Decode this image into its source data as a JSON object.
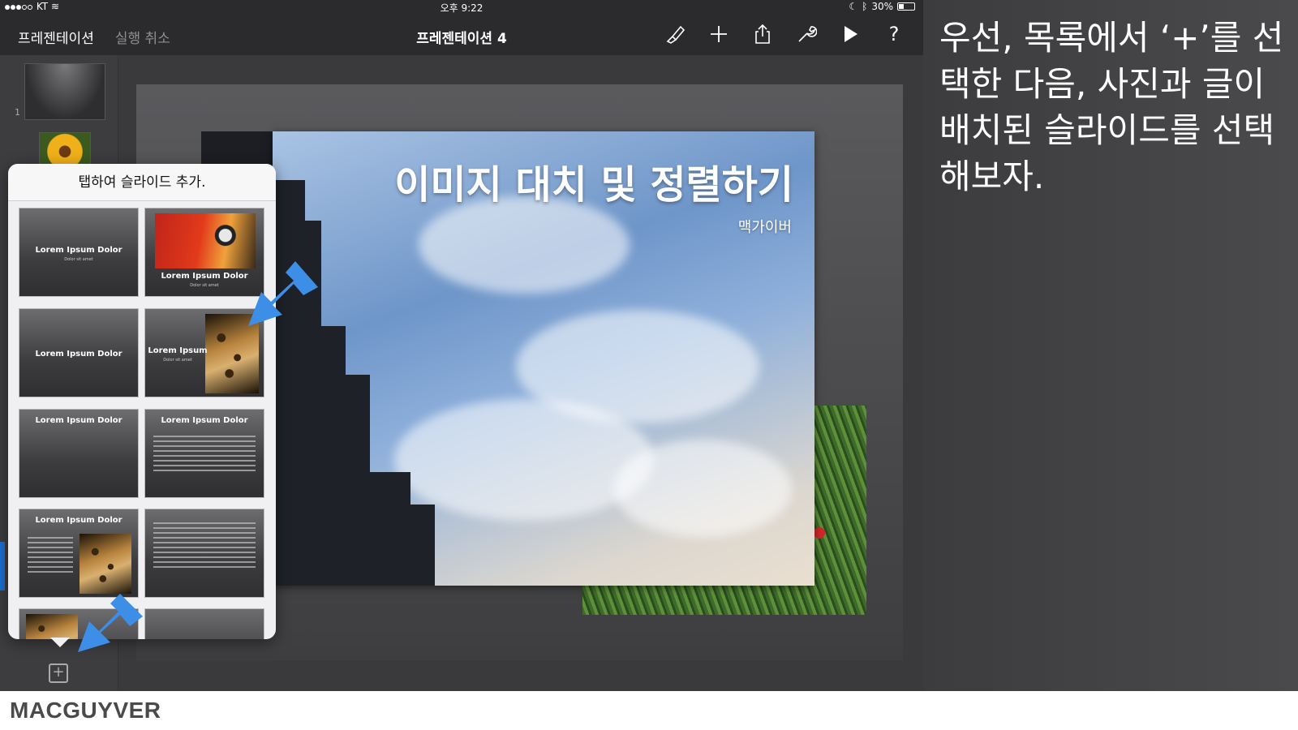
{
  "status_bar": {
    "carrier": "KT",
    "time": "오후 9:22",
    "battery": "30%"
  },
  "toolbar": {
    "back_label": "프레젠테이션",
    "undo_label": "실행 취소",
    "document_title": "프레젠테이션 4",
    "icons": [
      "paintbrush-icon",
      "plus-icon",
      "share-icon",
      "wrench-icon",
      "play-icon",
      "help-icon"
    ],
    "help_label": "?"
  },
  "navigator": {
    "slide_number": "1",
    "add_button_label": "+"
  },
  "slide": {
    "title": "이미지 대치 및 정렬하기",
    "subtitle": "맥가이버"
  },
  "popover": {
    "title": "탭하여 슬라이드 추가.",
    "layouts": [
      {
        "title": "Lorem Ipsum Dolor",
        "subtitle": "Dolor sit amet",
        "kind": "title-center"
      },
      {
        "title": "Lorem Ipsum Dolor",
        "subtitle": "Dolor sit amet",
        "kind": "photo-top-parrot"
      },
      {
        "title": "Lorem Ipsum Dolor",
        "kind": "title-only-center"
      },
      {
        "title": "Lorem Ipsum",
        "subtitle": "Dolor sit amet",
        "kind": "photo-right-leopard"
      },
      {
        "title": "Lorem Ipsum Dolor",
        "kind": "title-top"
      },
      {
        "title": "Lorem Ipsum Dolor",
        "kind": "title-bullets"
      },
      {
        "title": "Lorem Ipsum Dolor",
        "kind": "title-bullets-photo"
      },
      {
        "kind": "bullets-only"
      },
      {
        "kind": "photo-partial-leopard"
      },
      {
        "kind": "blank"
      }
    ]
  },
  "instruction": {
    "text": "우선, 목록에서 ‘+’를 선택한 다음, 사진과 글이 배치된 슬라이드를 선택해보자."
  },
  "footer": {
    "brand": "MACGUYVER"
  },
  "colors": {
    "arrow_blue": "#3d8ee6",
    "toolbar_bg": "#2b2b2e"
  }
}
